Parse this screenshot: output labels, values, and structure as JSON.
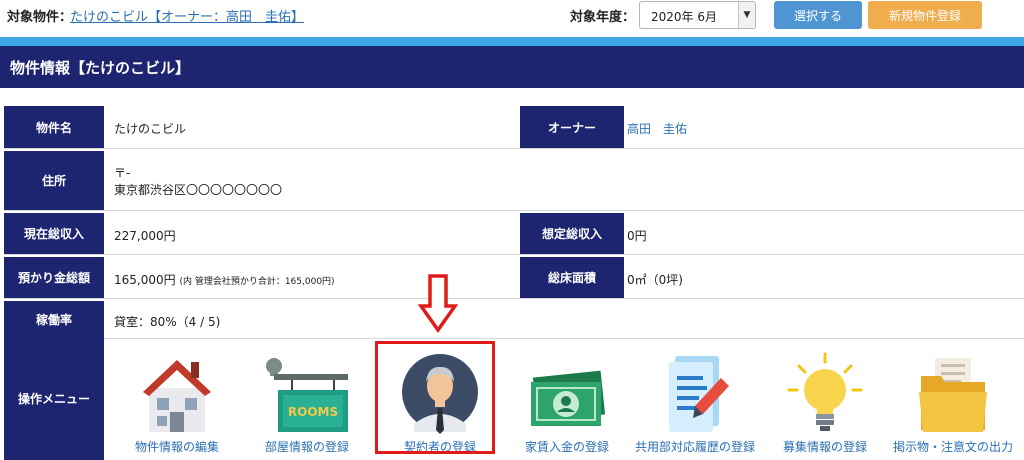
{
  "topbar": {
    "target_label": "対象物件：",
    "target_link": "たけのこビル【オーナー：高田　圭佑】",
    "year_label": "対象年度：",
    "year_value": "2020年 6月",
    "select_button": "選択する",
    "new_button": "新規物件登録"
  },
  "header": {
    "title": "物件情報【たけのこビル】"
  },
  "info": {
    "name_label": "物件名",
    "name_value": "たけのこビル",
    "owner_label": "オーナー",
    "owner_value": "高田　圭佑",
    "address_label": "住所",
    "postal": "〒-",
    "address": "東京都渋谷区〇〇〇〇〇〇〇〇",
    "current_income_label": "現在総収入",
    "current_income_value": "227,000円",
    "expected_income_label": "想定総収入",
    "expected_income_value": "0円",
    "deposit_label": "預かり金総額",
    "deposit_value": "165,000円",
    "deposit_note": "(内 管理会社預かり合計：165,000円)",
    "floor_area_label": "総床面積",
    "floor_area_value": "0㎡（0坪)",
    "occupancy_label": "稼働率",
    "occupancy_value": "貸室：80%（4 / 5)"
  },
  "menu": {
    "label": "操作メニュー",
    "items": [
      {
        "label": "物件情報の編集",
        "icon": "house-icon"
      },
      {
        "label": "部屋情報の登録",
        "icon": "rooms-sign-icon"
      },
      {
        "label": "契約者の登録",
        "icon": "contractor-person-icon"
      },
      {
        "label": "家賃入金の登録",
        "icon": "money-bill-icon"
      },
      {
        "label": "共用部対応履歴の登録",
        "icon": "document-pen-icon"
      },
      {
        "label": "募集情報の登録",
        "icon": "lightbulb-icon"
      },
      {
        "label": "掲示物・注意文の出力",
        "icon": "folder-icon"
      }
    ]
  },
  "annotation": {
    "arrow_color": "#e11a1a",
    "highlight_color": "#e11a1a"
  },
  "colors": {
    "navy": "#1d2470",
    "stripe": "#3da6e6",
    "link": "#2a6fb5",
    "select_button": "#4f95d3",
    "new_button": "#f0ad4e"
  }
}
